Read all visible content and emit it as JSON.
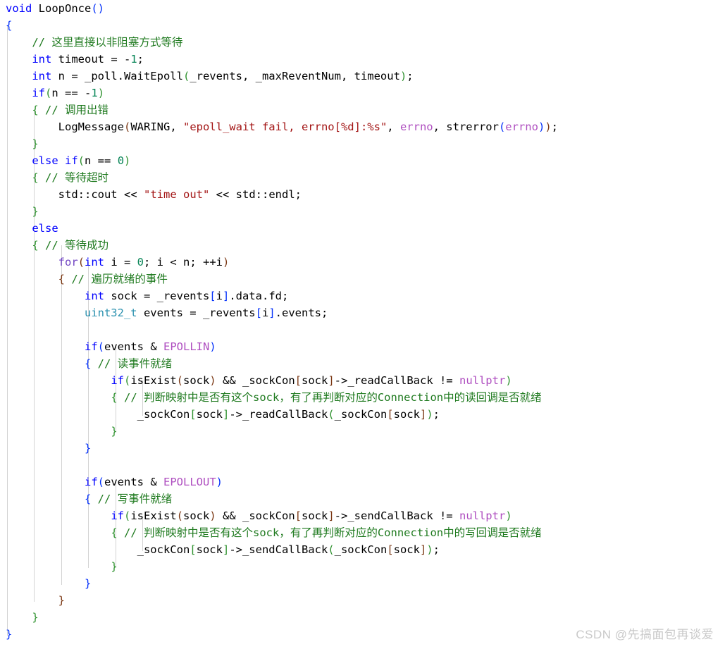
{
  "editor": {
    "language": "cpp",
    "background_color": "#ffffff",
    "foreground_color": "#000000",
    "indent_guide_color": "#d3d3d3",
    "colors": {
      "keyword": "#0000ff",
      "control_keyword": "#6f42c1",
      "type": "#2b91af",
      "string": "#a31515",
      "comment": "#1f7a1f",
      "number": "#098658",
      "macro": "#af4fc0",
      "bracket_level_1": "#0431fa",
      "bracket_level_2": "#319331",
      "bracket_level_3": "#7b3814"
    }
  },
  "code": {
    "lines": [
      "void LoopOnce()",
      "{",
      "    // 这里直接以非阻塞方式等待",
      "    int timeout = -1;",
      "    int n = _poll.WaitEpoll(_revents, _maxReventNum, timeout);",
      "    if(n == -1)",
      "    { // 调用出错",
      "        LogMessage(WARING, \"epoll_wait fail, errno[%d]:%s\", errno, strerror(errno));",
      "    }",
      "    else if(n == 0)",
      "    { // 等待超时",
      "        std::cout << \"time out\" << std::endl;",
      "    }",
      "    else",
      "    { // 等待成功",
      "        for(int i = 0; i < n; ++i)",
      "        { // 遍历就绪的事件",
      "            int sock = _revents[i].data.fd;",
      "            uint32_t events = _revents[i].events;",
      "",
      "            if(events & EPOLLIN)",
      "            { // 读事件就绪",
      "                if(isExist(sock) && _sockCon[sock]->_readCallBack != nullptr)",
      "                { // 判断映射中是否有这个sock，有了再判断对应的Connection中的读回调是否就绪",
      "                    _sockCon[sock]->_readCallBack(_sockCon[sock]);",
      "                }",
      "            }",
      "",
      "            if(events & EPOLLOUT)",
      "            { // 写事件就绪",
      "                if(isExist(sock) && _sockCon[sock]->_sendCallBack != nullptr)",
      "                { // 判断映射中是否有这个sock，有了再判断对应的Connection中的写回调是否就绪",
      "                    _sockCon[sock]->_sendCallBack(_sockCon[sock]);",
      "                }",
      "            }",
      "        }",
      "    }",
      "}"
    ],
    "function_name": "LoopOnce",
    "return_type": "void",
    "comments": [
      "// 这里直接以非阻塞方式等待",
      "// 调用出错",
      "// 等待超时",
      "// 等待成功",
      "// 遍历就绪的事件",
      "// 读事件就绪",
      "// 判断映射中是否有这个sock，有了再判断对应的Connection中的读回调是否就绪",
      "// 写事件就绪",
      "// 判断映射中是否有这个sock，有了再判断对应的Connection中的写回调是否就绪"
    ],
    "strings": [
      "\"epoll_wait fail, errno[%d]:%s\"",
      "\"time out\""
    ],
    "identifiers": [
      "_poll",
      "WaitEpoll",
      "_revents",
      "_maxReventNum",
      "timeout",
      "LogMessage",
      "WARING",
      "errno",
      "strerror",
      "std::cout",
      "std::endl",
      "sock",
      "events",
      "EPOLLIN",
      "EPOLLOUT",
      "isExist",
      "_sockCon",
      "_readCallBack",
      "_sendCallBack",
      "nullptr"
    ],
    "indent_guide_x": [
      10,
      48,
      87,
      125,
      164,
      202
    ]
  },
  "watermark": {
    "text": "CSDN @先搞面包再谈爱"
  }
}
